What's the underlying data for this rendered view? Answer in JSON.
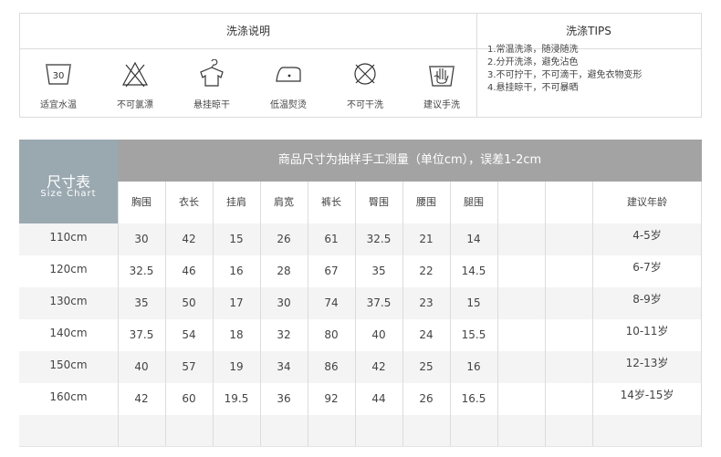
{
  "care": {
    "title_left": "洗涤说明",
    "title_right": "洗涤TIPS",
    "symbols": [
      {
        "icon": "wash-30-icon",
        "label": "适宜水温",
        "temp": "30"
      },
      {
        "icon": "no-bleach-icon",
        "label": "不可氯漂"
      },
      {
        "icon": "hang-dry-icon",
        "label": "悬挂晾干"
      },
      {
        "icon": "low-iron-icon",
        "label": "低温熨烫"
      },
      {
        "icon": "no-dry-clean-icon",
        "label": "不可干洗"
      },
      {
        "icon": "hand-wash-icon",
        "label": "建议手洗"
      }
    ],
    "tips": [
      "1.常温洗涤，随浸随洗",
      "2.分开洗涤，避免沾色",
      "3.不可拧干，不可滴干，避免衣物变形",
      "4.悬挂晾干，不可暴晒"
    ]
  },
  "size_chart": {
    "title_cn": "尺寸表",
    "title_en": "Size Chart",
    "note": "商品尺寸为抽样手工测量（单位cm），误差1-2cm",
    "columns": [
      "胸围",
      "衣长",
      "挂肩",
      "肩宽",
      "裤长",
      "臀围",
      "腰围",
      "腿围",
      "",
      ""
    ],
    "age_header": "建议年龄",
    "rows": [
      {
        "size": "110cm",
        "values": [
          "30",
          "42",
          "15",
          "26",
          "61",
          "32.5",
          "21",
          "14",
          "",
          ""
        ],
        "age": "4-5岁"
      },
      {
        "size": "120cm",
        "values": [
          "32.5",
          "46",
          "16",
          "28",
          "67",
          "35",
          "22",
          "14.5",
          "",
          ""
        ],
        "age": "6-7岁"
      },
      {
        "size": "130cm",
        "values": [
          "35",
          "50",
          "17",
          "30",
          "74",
          "37.5",
          "23",
          "15",
          "",
          ""
        ],
        "age": "8-9岁"
      },
      {
        "size": "140cm",
        "values": [
          "37.5",
          "54",
          "18",
          "32",
          "80",
          "40",
          "24",
          "15.5",
          "",
          ""
        ],
        "age": "10-11岁"
      },
      {
        "size": "150cm",
        "values": [
          "40",
          "57",
          "19",
          "34",
          "86",
          "42",
          "25",
          "16",
          "",
          ""
        ],
        "age": "12-13岁"
      },
      {
        "size": "160cm",
        "values": [
          "42",
          "60",
          "19.5",
          "36",
          "92",
          "44",
          "26",
          "16.5",
          "",
          ""
        ],
        "age": "14岁-15岁"
      },
      {
        "size": "",
        "values": [
          "",
          "",
          "",
          "",
          "",
          "",
          "",
          "",
          "",
          ""
        ],
        "age": ""
      }
    ]
  }
}
